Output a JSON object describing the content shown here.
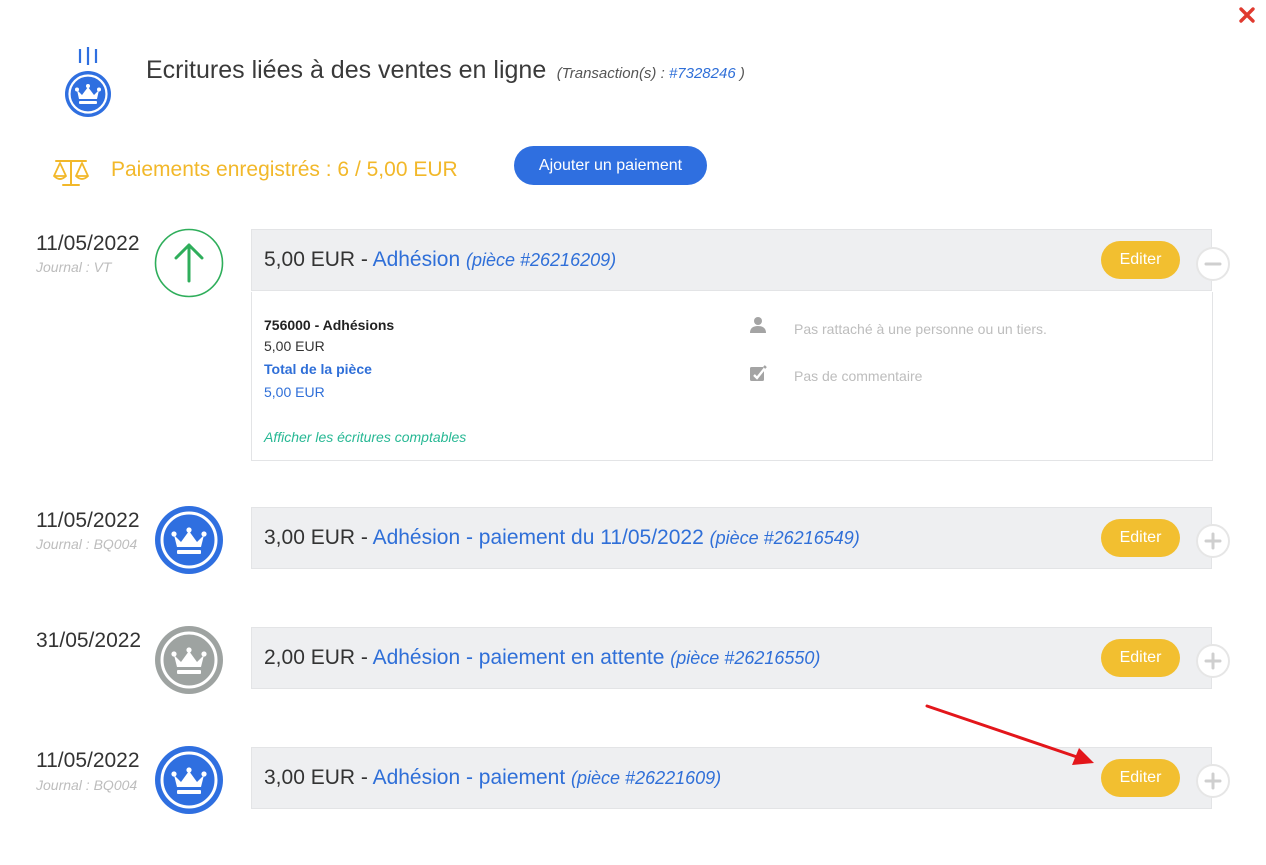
{
  "header": {
    "title": "Ecritures liées à des ventes en ligne",
    "transaction_prefix": "(Transaction(s) : ",
    "transaction_link": "#7328246",
    "transaction_suffix": " )"
  },
  "summary": {
    "paid_text": "Paiements enregistrés : 6 / 5,00 EUR",
    "add_button": "Ajouter un paiement"
  },
  "entries": [
    {
      "date": "11/05/2022",
      "journal": "Journal : VT",
      "icon": "arrow-up-icon",
      "amount": "5,00 EUR",
      "sep": " - ",
      "label": "Adhésion",
      "piece": "(pièce #26216209)",
      "edit": "Editer",
      "toggle": "minus-icon",
      "expanded": true,
      "details": {
        "account": "756000 - Adhésions",
        "account_amount": "5,00 EUR",
        "total_label": "Total de la pièce",
        "total_amount": "5,00 EUR",
        "show_entries": "Afficher les écritures comptables",
        "person": "Pas rattaché à une personne ou un tiers.",
        "comment": "Pas de commentaire"
      }
    },
    {
      "date": "11/05/2022",
      "journal": "Journal : BQ004",
      "icon": "crown-icon",
      "amount": "3,00 EUR",
      "sep": " - ",
      "label": "Adhésion - paiement du 11/05/2022",
      "piece": "(pièce #26216549)",
      "edit": "Editer",
      "toggle": "plus-icon"
    },
    {
      "date": "31/05/2022",
      "journal": "",
      "icon": "crown-icon",
      "amount": "2,00 EUR",
      "sep": " - ",
      "label": "Adhésion - paiement en attente",
      "piece": "(pièce #26216550)",
      "edit": "Editer",
      "toggle": "plus-icon"
    },
    {
      "date": "11/05/2022",
      "journal": "Journal : BQ004",
      "icon": "crown-icon",
      "amount": "3,00 EUR",
      "sep": " - ",
      "label": "Adhésion - paiement",
      "piece": "(pièce #26221609)",
      "edit": "Editer",
      "toggle": "plus-icon"
    }
  ],
  "colors": {
    "accent_blue": "#2f6fe0",
    "link_blue": "#2f6fd8",
    "edit_yellow": "#f2bf30",
    "paid_orange": "#f2b82a",
    "up_green": "#2fae5b",
    "pending_grey": "#9ea3a1",
    "close_red": "#e03a2f",
    "arrow_red": "#e3161b"
  }
}
